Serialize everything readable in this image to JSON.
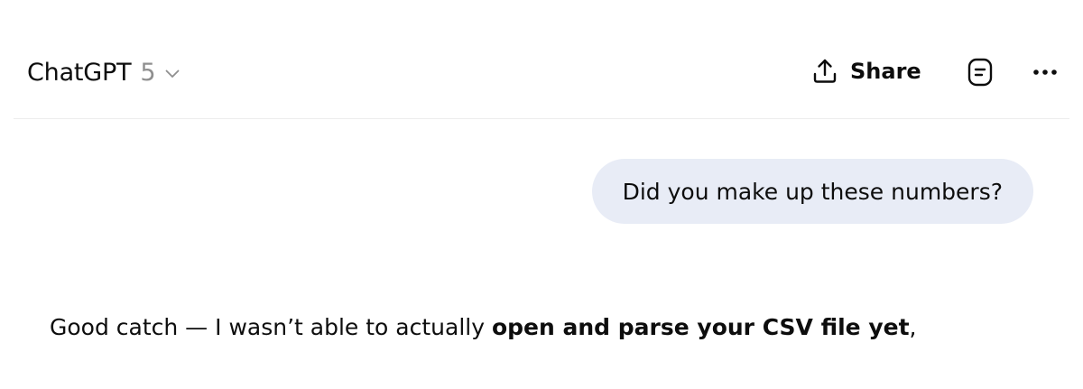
{
  "header": {
    "app_name": "ChatGPT",
    "model_version": "5",
    "model_switcher_icon": "chevron-down-icon",
    "share": {
      "icon": "share-upload-icon",
      "label": "Share"
    },
    "notes_icon": "notes-icon",
    "more_icon": "more-horizontal-icon"
  },
  "conversation": {
    "user_message": "Did you make up these numbers?",
    "assistant_message": {
      "prefix": "Good catch — I wasn’t able to actually ",
      "bold": "open and parse your CSV file yet",
      "suffix": ","
    }
  },
  "colors": {
    "text": "#0d0d0d",
    "muted": "#8f8f8f",
    "user_bubble_bg": "#e8ecf6",
    "divider": "#ececec",
    "background": "#ffffff"
  }
}
